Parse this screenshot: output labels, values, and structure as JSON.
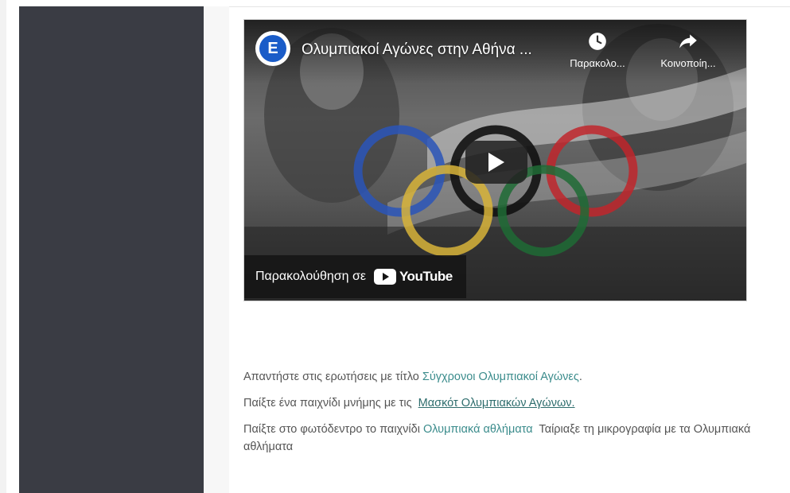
{
  "video": {
    "channel_letter": "E",
    "title": "Ολυμπιακοί Αγώνες στην Αθήνα ...",
    "watch_later_label": "Παρακολο...",
    "share_label": "Κοινοποίη...",
    "watch_on_label": "Παρακολούθηση σε",
    "youtube_wordmark": "YouTube",
    "icons": [
      "clock-icon",
      "share-arrow-icon",
      "play-icon",
      "youtube-logo-icon"
    ],
    "colors": {
      "channel_blue": "#1a5cc8",
      "youtube_red": "#ff0000"
    }
  },
  "links": [
    {
      "before": "Απαντήστε στις ερωτήσεις με τίτλο ",
      "link": "Σύγχρονοι Ολυμπιακοί Αγώνες",
      "after": "."
    },
    {
      "before": "Παίξτε ένα παιχνίδι μνήμης με τις  ",
      "link": "Μασκότ Ολυμπιακών Αγώνων.",
      "after": ""
    },
    {
      "before": "Παίξτε στο φωτόδεντρο το παιχνίδι ",
      "link": "Ολυμπιακά αθλήματα",
      "after": "  Ταίριαξε τη μικρογραφία με τα Ολυμπιακά αθλήματα"
    }
  ],
  "colors": {
    "sidebar": "#3a3c44",
    "link": "#3b8c8c"
  }
}
